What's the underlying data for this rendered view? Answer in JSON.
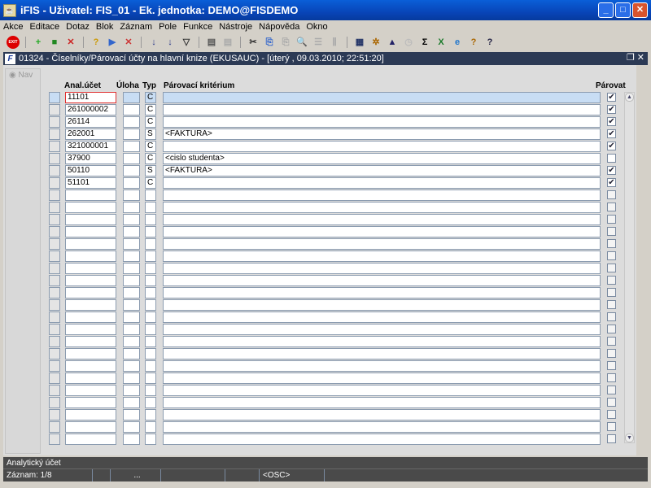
{
  "window": {
    "title": "iFIS - Uživatel: FIS_01 - Ek. jednotka: DEMO@FISDEMO"
  },
  "menu": [
    "Akce",
    "Editace",
    "Dotaz",
    "Blok",
    "Záznam",
    "Pole",
    "Funkce",
    "Nástroje",
    "Nápověda",
    "Okno"
  ],
  "toolbar": [
    {
      "icon": "exit-icon",
      "g": "EXIT",
      "c": "#d00"
    },
    {
      "sep": true
    },
    {
      "icon": "insert-record-icon",
      "g": "+",
      "c": "#2a2"
    },
    {
      "icon": "save-icon",
      "g": "■",
      "c": "#282"
    },
    {
      "icon": "delete-record-icon",
      "g": "✕",
      "c": "#c22"
    },
    {
      "sep": true
    },
    {
      "icon": "query-icon",
      "g": "?",
      "c": "#c90"
    },
    {
      "icon": "execute-query-icon",
      "g": "▶",
      "c": "#36c"
    },
    {
      "icon": "cancel-query-icon",
      "g": "✕",
      "c": "#c33"
    },
    {
      "sep": true
    },
    {
      "icon": "sort-asc-icon",
      "g": "↓",
      "c": "#238"
    },
    {
      "icon": "sort-desc-icon",
      "g": "↓",
      "c": "#238"
    },
    {
      "icon": "filter-icon",
      "g": "▽",
      "c": "#333"
    },
    {
      "sep": true
    },
    {
      "icon": "print-icon",
      "g": "▤",
      "c": "#555"
    },
    {
      "icon": "print-setup-icon",
      "g": "▤",
      "c": "#aaa"
    },
    {
      "sep": true
    },
    {
      "icon": "cut-icon",
      "g": "✂",
      "c": "#333"
    },
    {
      "icon": "copy-icon",
      "g": "⎘",
      "c": "#36c"
    },
    {
      "icon": "paste-icon",
      "g": "⎘",
      "c": "#aaa"
    },
    {
      "icon": "find-icon",
      "g": "🔍",
      "c": "#36c"
    },
    {
      "icon": "list-icon",
      "g": "☰",
      "c": "#aaa"
    },
    {
      "icon": "columns-icon",
      "g": "⫼",
      "c": "#aaa"
    },
    {
      "sep": true
    },
    {
      "icon": "calculator-icon",
      "g": "▦",
      "c": "#236"
    },
    {
      "icon": "wheel-icon",
      "g": "✲",
      "c": "#a60"
    },
    {
      "icon": "triangle-icon",
      "g": "▲",
      "c": "#226"
    },
    {
      "icon": "clock-icon",
      "g": "◷",
      "c": "#bbb"
    },
    {
      "icon": "sum-icon",
      "g": "Σ",
      "c": "#000"
    },
    {
      "icon": "excel-icon",
      "g": "X",
      "c": "#1a7a2a"
    },
    {
      "icon": "browser-icon",
      "g": "e",
      "c": "#27c"
    },
    {
      "icon": "help-icon",
      "g": "?",
      "c": "#a60"
    },
    {
      "icon": "context-help-icon",
      "g": "?",
      "c": "#224"
    }
  ],
  "form": {
    "title": "01324 - Číselníky/Párovací účty na hlavní knize (EKUSAUC) - [úterý  , 09.03.2010; 22:51:20]",
    "nav": "Nav",
    "headers": {
      "anal": "Anal.účet",
      "uloha": "Úloha",
      "typ": "Typ",
      "krit": "Párovací kritérium",
      "parovat": "Párovat"
    }
  },
  "rows": [
    {
      "anal": "11101",
      "uloha": "",
      "typ": "C",
      "krit": "",
      "parovat": true
    },
    {
      "anal": "261000002",
      "uloha": "",
      "typ": "C",
      "krit": "",
      "parovat": true
    },
    {
      "anal": "26114",
      "uloha": "",
      "typ": "C",
      "krit": "",
      "parovat": true
    },
    {
      "anal": "262001",
      "uloha": "",
      "typ": "S",
      "krit": "<FAKTURA>",
      "parovat": true
    },
    {
      "anal": "321000001",
      "uloha": "",
      "typ": "C",
      "krit": "",
      "parovat": true
    },
    {
      "anal": "37900",
      "uloha": "",
      "typ": "C",
      "krit": "<cislo studenta>",
      "parovat": false
    },
    {
      "anal": "50110",
      "uloha": "",
      "typ": "S",
      "krit": "<FAKTURA>",
      "parovat": true
    },
    {
      "anal": "51101",
      "uloha": "",
      "typ": "C",
      "krit": "",
      "parovat": true
    }
  ],
  "empty_rows": 21,
  "status": {
    "hint": "Analytický účet",
    "record": "Záznam: 1/8",
    "ellipsis": "...",
    "mode": "<OSC>"
  }
}
